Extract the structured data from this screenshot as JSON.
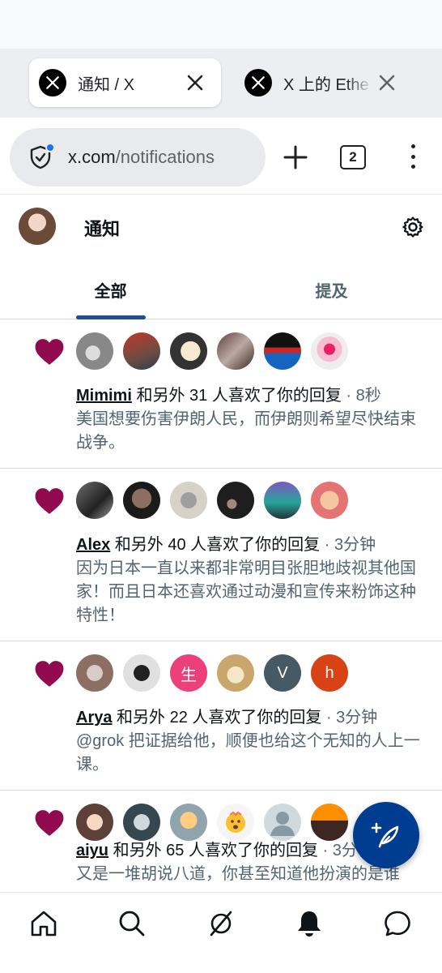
{
  "browser": {
    "tabs": [
      {
        "title": "通知 / X",
        "active": true,
        "favicon": "x-logo-icon"
      },
      {
        "title": "X 上的 Ethe",
        "active": false,
        "favicon": "x-logo-icon"
      }
    ],
    "url_domain": "x.com",
    "url_path": "/notifications",
    "tab_count": "2"
  },
  "header": {
    "title": "通知"
  },
  "tabs": [
    {
      "label": "全部",
      "selected": true
    },
    {
      "label": "提及",
      "selected": false
    }
  ],
  "notifications": [
    {
      "user": "Mimimi",
      "action": " 和另外 31 人喜欢了你的回复",
      "time": " · 8秒",
      "body": "美国想要伤害伊朗人民，而伊朗则希望尽快结束战争。"
    },
    {
      "user": "Alex",
      "action": " 和另外 40 人喜欢了你的回复",
      "time": " · 3分钟",
      "body": "因为日本一直以来都非常明目张胆地歧视其他国家！而且日本还喜欢通过动漫和宣传来粉饰这种特性！"
    },
    {
      "user": "Arya",
      "action": " 和另外 22 人喜欢了你的回复",
      "time": " · 3分钟",
      "body": "@grok 把证据给他，顺便也给这个无知的人上一课。"
    },
    {
      "user": "aiyu",
      "action": " 和另外 65 人喜欢了你的回复",
      "time": " · 3分钟",
      "body": "又是一堆胡说八道，你甚至知道他扮演的是谁"
    }
  ],
  "letter_avatars": {
    "n3_a3": "生",
    "n3_a5": "V",
    "n3_a6": "h"
  },
  "colors": {
    "like": "#910a4f",
    "accent": "#1d4e99",
    "fab": "#003c8f"
  },
  "icons": {
    "bottom_nav": [
      "home-icon",
      "search-icon",
      "grok-icon",
      "notifications-icon",
      "messages-icon"
    ],
    "fab": "compose-post-icon"
  }
}
